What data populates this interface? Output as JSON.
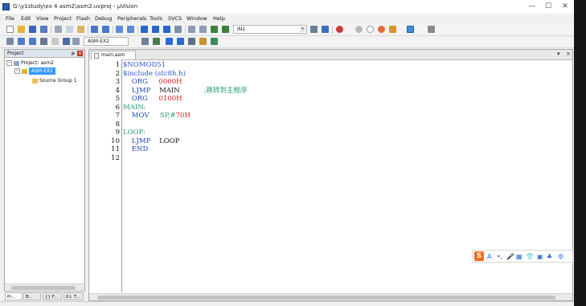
{
  "window": {
    "title": "G:\\y1study\\ex 4 asm2\\asm2.uvproj - µVision"
  },
  "menu": [
    "File",
    "Edit",
    "View",
    "Project",
    "Flash",
    "Debug",
    "Peripherals",
    "Tools",
    "SVCS",
    "Window",
    "Help"
  ],
  "toolbar1": {
    "target_combo": "IN1"
  },
  "toolbar2": {
    "target_select": "ASM-EX2"
  },
  "project_panel": {
    "title": "Project",
    "pin": "ᵽ",
    "root": "Project: asm2",
    "target": "ASM-EX2",
    "group": "Source Group 1",
    "tabs": [
      "Pr...",
      "B...",
      "{} F...",
      "0↓ T..."
    ]
  },
  "editor": {
    "tab": "main.asm",
    "line_numbers": [
      "1",
      "2",
      "3",
      "4",
      "5",
      "6",
      "7",
      "8",
      "9",
      "10",
      "11",
      "12"
    ],
    "lines": [
      [
        {
          "t": "$NOMOD51",
          "c": "dir"
        }
      ],
      [
        {
          "t": "$include (stc8h.h)",
          "c": "dir"
        }
      ],
      [
        {
          "t": "    ORG     ",
          "c": "kw"
        },
        {
          "t": "0000H",
          "c": "num"
        }
      ],
      [
        {
          "t": "    LJMP    ",
          "c": "kw"
        },
        {
          "t": "MAIN",
          "c": "plain"
        },
        {
          "t": "           ;跳转到主程序",
          "c": "cmt"
        }
      ],
      [
        {
          "t": "    ORG     ",
          "c": "kw"
        },
        {
          "t": "0100H",
          "c": "num"
        }
      ],
      [
        {
          "t": "MAIN:",
          "c": "lbl"
        }
      ],
      [
        {
          "t": "    MOV     ",
          "c": "kw"
        },
        {
          "t": "SP,#",
          "c": "lbl"
        },
        {
          "t": "70H",
          "c": "num"
        }
      ],
      [],
      [
        {
          "t": "LOOP:",
          "c": "lbl"
        }
      ],
      [
        {
          "t": "    LJMP    ",
          "c": "kw"
        },
        {
          "t": "LOOP",
          "c": "plain"
        }
      ],
      [
        {
          "t": "    END",
          "c": "kw"
        }
      ],
      []
    ]
  },
  "ime_toolbar": {
    "logo": "S",
    "items": [
      "A",
      "•,",
      "🎤",
      "▦",
      "👕",
      "▣",
      "♣",
      "⚙"
    ]
  },
  "colors": {
    "selection": "#3399ff",
    "directive": "#2e55d6",
    "keyword": "#1b3fc7",
    "number": "#d02020",
    "label": "#2a9d6a"
  }
}
